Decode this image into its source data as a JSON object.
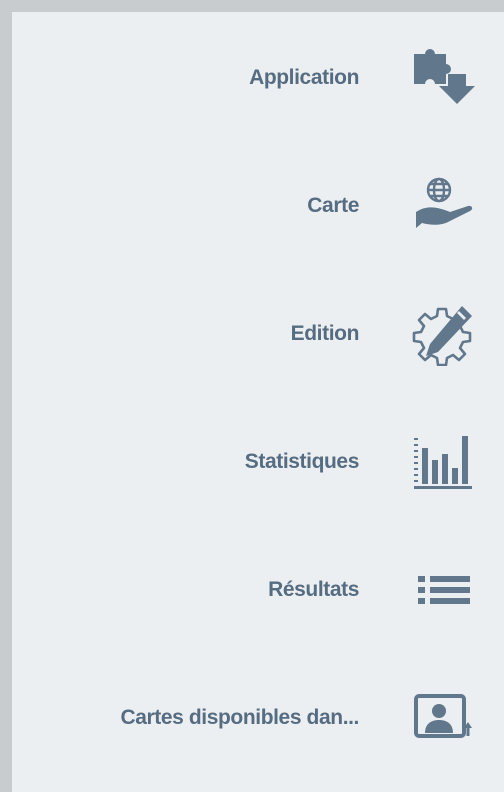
{
  "menu": {
    "items": [
      {
        "label": "Application",
        "icon": "puzzle-download-icon"
      },
      {
        "label": "Carte",
        "icon": "globe-hand-icon"
      },
      {
        "label": "Edition",
        "icon": "gear-pencil-icon"
      },
      {
        "label": "Statistiques",
        "icon": "bar-chart-icon"
      },
      {
        "label": "Résultats",
        "icon": "list-icon"
      },
      {
        "label": "Cartes disponibles dan...",
        "icon": "user-card-icon"
      }
    ]
  },
  "colors": {
    "panel_background": "#eceff2",
    "text": "#566c81",
    "icon": "#61778c"
  }
}
